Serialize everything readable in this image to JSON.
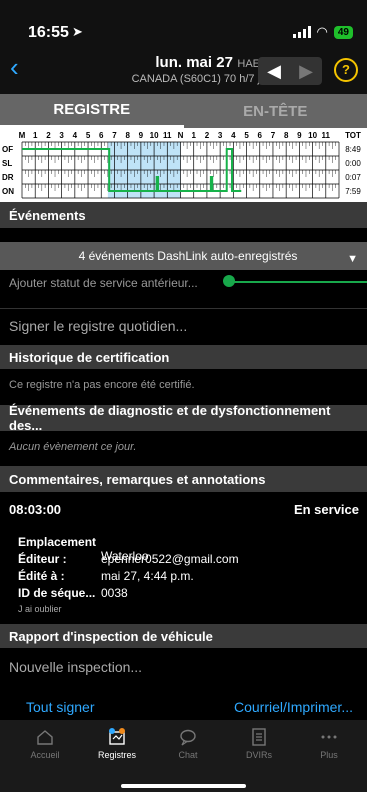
{
  "status_bar": {
    "time": "16:55",
    "battery": "49"
  },
  "header": {
    "date": "lun. mai 27",
    "timezone": "HAE",
    "cycle": "CANADA (S60C1) 70 h/7 j",
    "help_label": "?"
  },
  "tabs": [
    {
      "label": "REGISTRE",
      "active": true
    },
    {
      "label": "EN-TÊTE",
      "active": false
    }
  ],
  "grid": {
    "hours_am": [
      "M",
      "1",
      "2",
      "3",
      "4",
      "5",
      "6",
      "7",
      "8",
      "9",
      "10",
      "11",
      "N"
    ],
    "hours_pm": [
      "1",
      "2",
      "3",
      "4",
      "5",
      "6",
      "7",
      "8",
      "9",
      "10",
      "11"
    ],
    "total_label": "TOT",
    "rows": [
      {
        "code": "OF",
        "total": "8:49"
      },
      {
        "code": "SL",
        "total": "0:00"
      },
      {
        "code": "DR",
        "total": "0:07"
      },
      {
        "code": "ON",
        "total": "7:59"
      }
    ],
    "line_color": "#17b24a",
    "highlight_color": "#bfe3f7"
  },
  "events": {
    "title": "Événements",
    "dropdown_label": "4 événements DashLink auto-enregistrés",
    "add_prior_status": "Ajouter statut de service antérieur...",
    "sign_log": "Signer le registre quotidien..."
  },
  "certification": {
    "title": "Historique de certification",
    "text": "Ce registre n'a pas encore été certifié."
  },
  "diagnostics": {
    "title": "Événements de diagnostic et de dysfonctionnement des...",
    "text": "Aucun évènement ce jour."
  },
  "comments": {
    "title": "Commentaires, remarques et annotations",
    "time": "08:03:00",
    "status": "En service",
    "fields": [
      {
        "label": "Emplacement :",
        "value": "Waterloo"
      },
      {
        "label": "Éditeur :",
        "value": "epenner0522@gmail.com"
      },
      {
        "label": "Édité à :",
        "value": "mai 27, 4:44 p.m."
      },
      {
        "label": "ID de séque...",
        "value": "0038"
      }
    ],
    "note": "J ai oublier"
  },
  "inspection": {
    "title": "Rapport d'inspection de véhicule",
    "new_label": "Nouvelle inspection..."
  },
  "actions": {
    "sign_all": "Tout signer",
    "email_print": "Courriel/Imprimer..."
  },
  "tab_bar": [
    {
      "label": "Accueil",
      "icon": "home-icon",
      "active": false
    },
    {
      "label": "Registres",
      "icon": "logbook-icon",
      "active": true
    },
    {
      "label": "Chat",
      "icon": "chat-icon",
      "active": false
    },
    {
      "label": "DVIRs",
      "icon": "checklist-icon",
      "active": false
    },
    {
      "label": "Plus",
      "icon": "more-icon",
      "active": false
    }
  ],
  "colors": {
    "accent": "#2fa9ff",
    "help": "#f5c400",
    "active_line": "#17b24a"
  }
}
